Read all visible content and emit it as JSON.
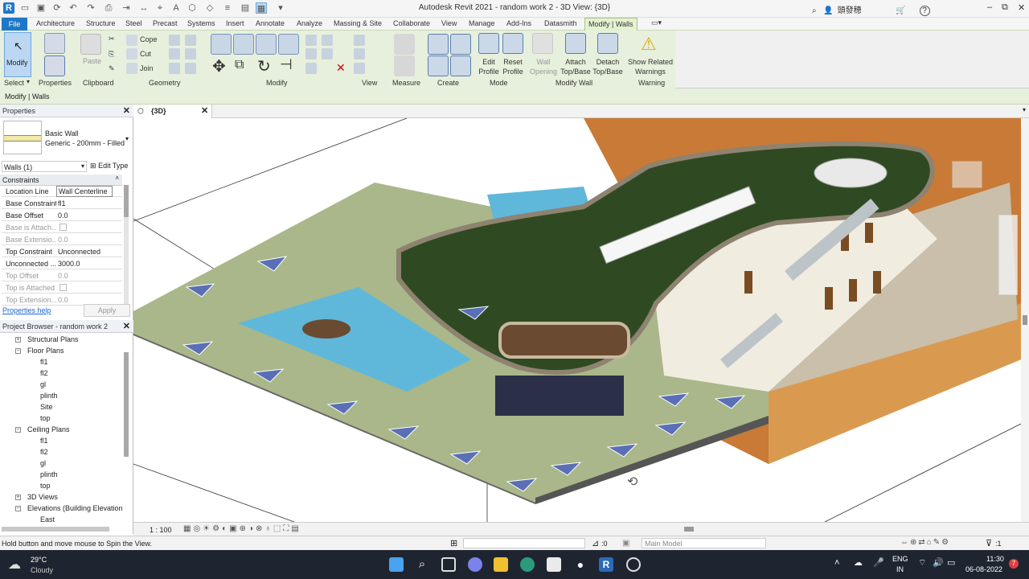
{
  "titlebar": {
    "title": "Autodesk Revit 2021 - random work 2 - 3D View: {3D}",
    "user": "頭發穂",
    "help": "?",
    "min": "–",
    "restore": "⧉",
    "close": "✕"
  },
  "tabs": [
    "File",
    "Architecture",
    "Structure",
    "Steel",
    "Precast",
    "Systems",
    "Insert",
    "Annotate",
    "Analyze",
    "Massing & Site",
    "Collaborate",
    "View",
    "Manage",
    "Add-Ins",
    "Datasmith",
    "Modify | Walls"
  ],
  "ribbon": {
    "modify_label": "Modify",
    "select_label": "Select",
    "properties_label": "Properties",
    "paste_label": "Paste",
    "cope_label": "Cope",
    "cut_label": "Cut",
    "join_label": "Join",
    "clipboard_label": "Clipboard",
    "geometry_label": "Geometry",
    "modify_panel_label": "Modify",
    "view_label": "View",
    "measure_label": "Measure",
    "create_label": "Create",
    "edit_profile": "Edit Profile",
    "reset_profile": "Reset Profile",
    "wall_opening": "Wall Opening",
    "attach_topbase": "Attach Top/Base",
    "detach_topbase": "Detach Top/Base",
    "show_related_warnings": "Show Related Warnings",
    "mode_label": "Mode",
    "modify_wall_label": "Modify Wall",
    "warning_label": "Warning"
  },
  "context_bar": "Modify | Walls",
  "properties": {
    "title": "Properties",
    "type_family": "Basic Wall",
    "type_name": "Generic - 200mm - Filled",
    "selector": "Walls (1)",
    "edit_type": "Edit Type",
    "section": "Constraints",
    "rows": [
      {
        "k": "Location Line",
        "v": "Wall Centerline"
      },
      {
        "k": "Base Constraint",
        "v": "fl1"
      },
      {
        "k": "Base Offset",
        "v": "0.0"
      },
      {
        "k": "Base is Attach...",
        "v": ""
      },
      {
        "k": "Base Extensio...",
        "v": "0.0"
      },
      {
        "k": "Top Constraint",
        "v": "Unconnected"
      },
      {
        "k": "Unconnected ...",
        "v": "3000.0"
      },
      {
        "k": "Top Offset",
        "v": "0.0"
      },
      {
        "k": "Top is Attached",
        "v": ""
      },
      {
        "k": "Top Extension...",
        "v": "0.0"
      }
    ],
    "help_link": "Properties help",
    "apply": "Apply"
  },
  "browser": {
    "title": "Project Browser - random work 2",
    "items": [
      {
        "label": "Structural Plans",
        "level": 1,
        "box": "+"
      },
      {
        "label": "Floor Plans",
        "level": 1,
        "box": "−"
      },
      {
        "label": "fl1",
        "level": 2
      },
      {
        "label": "fl2",
        "level": 2
      },
      {
        "label": "gl",
        "level": 2
      },
      {
        "label": "plinth",
        "level": 2
      },
      {
        "label": "Site",
        "level": 2
      },
      {
        "label": "top",
        "level": 2
      },
      {
        "label": "Ceiling Plans",
        "level": 1,
        "box": "−"
      },
      {
        "label": "fl1",
        "level": 2
      },
      {
        "label": "fl2",
        "level": 2
      },
      {
        "label": "gl",
        "level": 2
      },
      {
        "label": "plinth",
        "level": 2
      },
      {
        "label": "top",
        "level": 2
      },
      {
        "label": "3D Views",
        "level": 1,
        "box": "+"
      },
      {
        "label": "Elevations (Building Elevation",
        "level": 1,
        "box": "−"
      },
      {
        "label": "East",
        "level": 2
      }
    ]
  },
  "view_tab": "{3D}",
  "scale": "1 : 100",
  "status": {
    "message": "Hold button and move mouse to Spin the View.",
    "selection_count": ":0",
    "model": "Main Model",
    "filter": ":1"
  },
  "taskbar": {
    "temp": "29°C",
    "weather": "Cloudy",
    "lang1": "ENG",
    "lang2": "IN",
    "time": "11:30",
    "date": "06-08-2022",
    "badge": "7"
  },
  "colors": {
    "file_tab": "#1e78c8",
    "contextual_green": "#e6f0dc",
    "roof_green": "#2f4a22",
    "ground": "#a9b78a",
    "pool": "#5fb8da",
    "wood": "#c87a36",
    "taskbar": "#1f2530"
  }
}
